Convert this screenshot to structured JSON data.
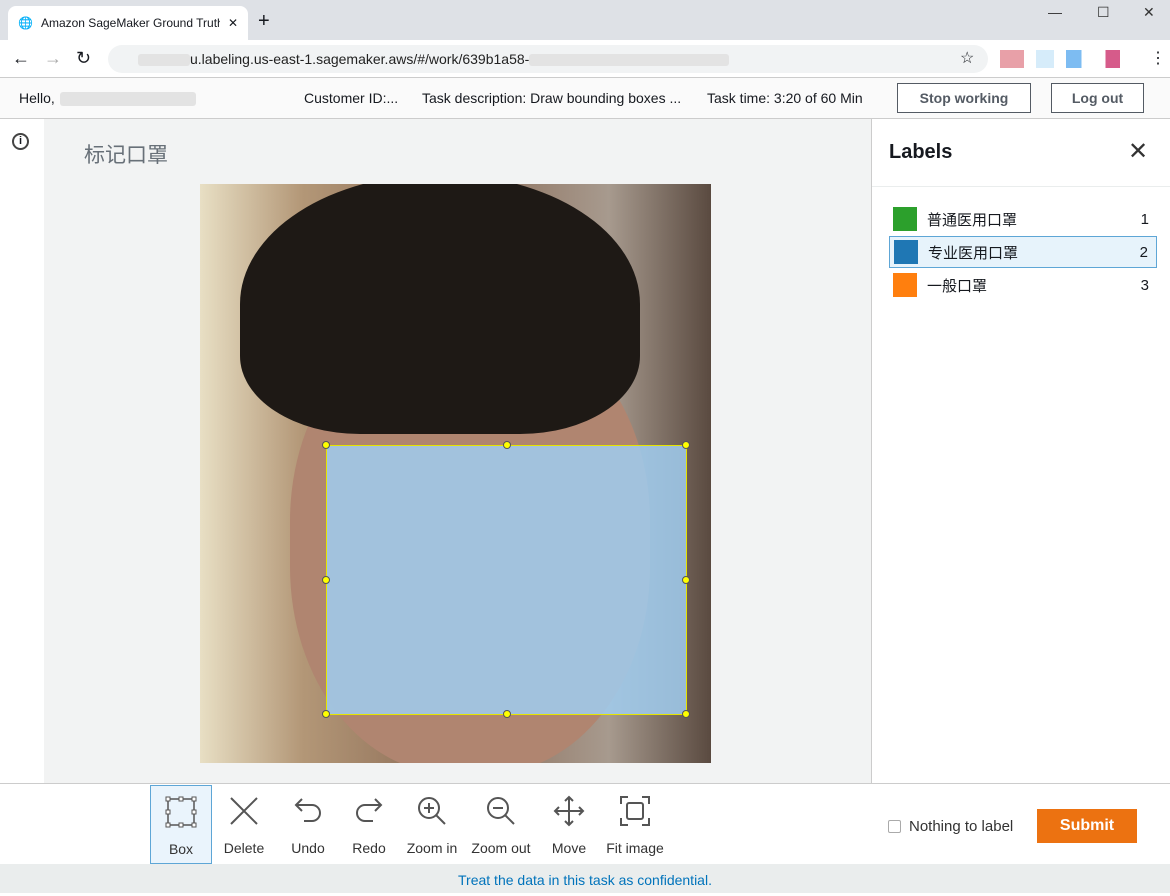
{
  "browser": {
    "tab_title": "Amazon SageMaker Ground Truth",
    "url": "u.labeling.us-east-1.sagemaker.aws/#/work/639b1a58-"
  },
  "header": {
    "hello": "Hello,",
    "customer_id": "Customer ID:...",
    "task_description": "Task description: Draw bounding boxes ...",
    "task_time": "Task time: 3:20 of 60 Min",
    "stop_working": "Stop working",
    "log_out": "Log out"
  },
  "main": {
    "title": "标记口罩"
  },
  "labels": {
    "title": "Labels",
    "items": [
      {
        "label": "普通医用口罩",
        "key": "1",
        "color": "#2ca02c"
      },
      {
        "label": "专业医用口罩",
        "key": "2",
        "color": "#1f77b4",
        "selected": true
      },
      {
        "label": "一般口罩",
        "key": "3",
        "color": "#ff7f0e"
      }
    ]
  },
  "toolbar": {
    "tools": [
      {
        "label": "Box",
        "icon": "box-icon",
        "selected": true
      },
      {
        "label": "Delete",
        "icon": "delete-icon"
      },
      {
        "label": "Undo",
        "icon": "undo-icon"
      },
      {
        "label": "Redo",
        "icon": "redo-icon"
      },
      {
        "label": "Zoom in",
        "icon": "zoom-in-icon"
      },
      {
        "label": "Zoom out",
        "icon": "zoom-out-icon"
      },
      {
        "label": "Move",
        "icon": "move-icon"
      },
      {
        "label": "Fit image",
        "icon": "fit-image-icon"
      }
    ],
    "nothing_to_label": "Nothing to label",
    "submit": "Submit"
  },
  "footer": {
    "text": "Treat the data in this task as confidential."
  },
  "colors": {
    "submit": "#ec7211",
    "link": "#0073bb"
  }
}
